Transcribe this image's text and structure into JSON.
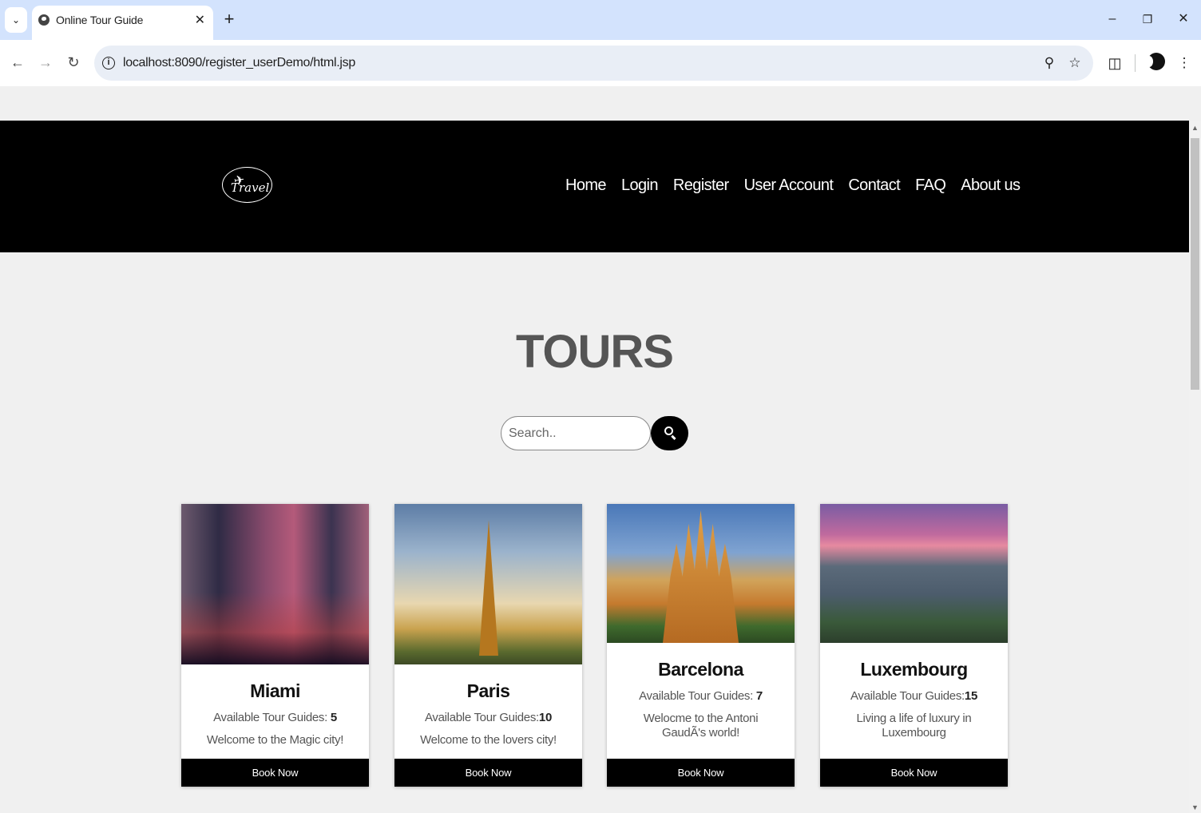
{
  "browser": {
    "tab_title": "Online Tour Guide",
    "url": "localhost:8090/register_userDemo/html.jsp",
    "icons": [
      "tab-search-icon",
      "globe-icon",
      "close-icon",
      "plus-icon",
      "minimize-icon",
      "restore-icon",
      "window-close-icon",
      "back-icon",
      "forward-icon",
      "reload-icon",
      "info-icon",
      "zoom-icon",
      "star-icon",
      "extensions-icon",
      "profile-avatar",
      "menu-icon"
    ]
  },
  "header": {
    "logo_text": "Travel",
    "nav": [
      "Home",
      "Login",
      "Register",
      "User Account",
      "Contact",
      "FAQ",
      "About us"
    ]
  },
  "main": {
    "title": "TOURS",
    "search": {
      "placeholder": "Search..",
      "button_icon": "search-icon"
    },
    "cards": [
      {
        "title": "Miami",
        "guides_label": "Available Tour Guides: ",
        "guides_count": "5",
        "description": "Welcome to the Magic city!",
        "button": "Book Now"
      },
      {
        "title": "Paris",
        "guides_label": "Available Tour Guides:",
        "guides_count": "10",
        "description": "Welcome to the lovers city!",
        "button": "Book Now"
      },
      {
        "title": "Barcelona",
        "guides_label": "Available Tour Guides: ",
        "guides_count": "7",
        "description": "Welocme to the Antoni GaudÃ's world!",
        "button": "Book Now"
      },
      {
        "title": "Luxembourg",
        "guides_label": "Available Tour Guides:",
        "guides_count": "15",
        "description": "Living a life of luxury in Luxembourg",
        "button": "Book Now"
      }
    ]
  },
  "colors": {
    "header_bg": "#000000",
    "page_bg": "#f0f0f0",
    "tabbar_bg": "#d3e3fd",
    "button_bg": "#000000"
  }
}
